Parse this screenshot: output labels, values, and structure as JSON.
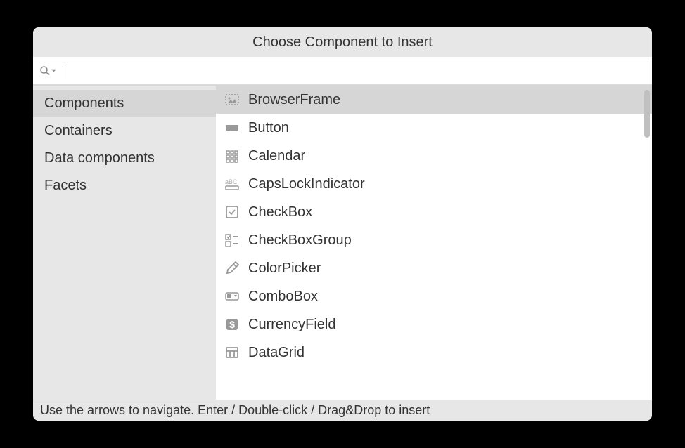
{
  "title": "Choose Component to Insert",
  "search": {
    "value": "",
    "placeholder": ""
  },
  "sidebar": {
    "items": [
      {
        "label": "Components",
        "selected": true
      },
      {
        "label": "Containers",
        "selected": false
      },
      {
        "label": "Data components",
        "selected": false
      },
      {
        "label": "Facets",
        "selected": false
      }
    ]
  },
  "list": {
    "items": [
      {
        "label": "BrowserFrame",
        "icon": "browser-frame-icon",
        "selected": true
      },
      {
        "label": "Button",
        "icon": "button-icon",
        "selected": false
      },
      {
        "label": "Calendar",
        "icon": "calendar-icon",
        "selected": false
      },
      {
        "label": "CapsLockIndicator",
        "icon": "capslock-icon",
        "selected": false
      },
      {
        "label": "CheckBox",
        "icon": "checkbox-icon",
        "selected": false
      },
      {
        "label": "CheckBoxGroup",
        "icon": "checkbox-group-icon",
        "selected": false
      },
      {
        "label": "ColorPicker",
        "icon": "color-picker-icon",
        "selected": false
      },
      {
        "label": "ComboBox",
        "icon": "combobox-icon",
        "selected": false
      },
      {
        "label": "CurrencyField",
        "icon": "currency-icon",
        "selected": false
      },
      {
        "label": "DataGrid",
        "icon": "datagrid-icon",
        "selected": false
      }
    ]
  },
  "footer": {
    "hint": "Use the arrows to navigate.  Enter / Double-click / Drag&Drop to insert"
  }
}
